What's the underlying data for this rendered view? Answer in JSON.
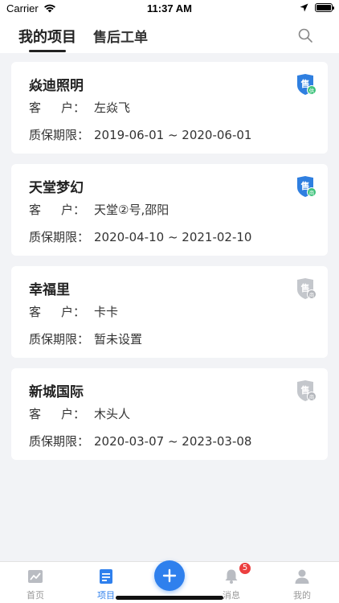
{
  "status_bar": {
    "carrier": "Carrier",
    "time": "11:37 AM"
  },
  "header": {
    "tabs": [
      {
        "label": "我的项目",
        "active": true
      },
      {
        "label": "售后工单",
        "active": false
      }
    ],
    "search_icon": "search-icon"
  },
  "projects": [
    {
      "name": "焱迪照明",
      "client_label": "客户：",
      "client": "左焱飞",
      "warranty_label": "质保期限：",
      "warranty": "2019-06-01 ~ 2020-06-01",
      "badge": {
        "char": "售",
        "sub": "供",
        "state": "active"
      }
    },
    {
      "name": "天堂梦幻",
      "client_label": "客户：",
      "client": "天堂②号,邵阳",
      "warranty_label": "质保期限：",
      "warranty": "2020-04-10 ~ 2021-02-10",
      "badge": {
        "char": "售",
        "sub": "商",
        "state": "active"
      }
    },
    {
      "name": "幸福里",
      "client_label": "客户：",
      "client": "卡卡",
      "warranty_label": "质保期限：",
      "warranty": "暂未设置",
      "badge": {
        "char": "售",
        "sub": "商",
        "state": "inactive"
      }
    },
    {
      "name": "新城国际",
      "client_label": "客户：",
      "client": "木头人",
      "warranty_label": "质保期限：",
      "warranty": "2020-03-07 ~ 2023-03-08",
      "badge": {
        "char": "售",
        "sub": "商",
        "state": "inactive"
      }
    }
  ],
  "tabbar": {
    "items": [
      {
        "label": "首页",
        "icon": "chart-icon",
        "active": false
      },
      {
        "label": "项目",
        "icon": "document-icon",
        "active": true
      },
      {
        "label": "消息",
        "icon": "bell-icon",
        "active": false,
        "badge": "5"
      },
      {
        "label": "我的",
        "icon": "person-icon",
        "active": false
      }
    ],
    "add_icon": "plus-icon"
  },
  "colors": {
    "accent": "#2f80ed",
    "badge_active": "#2f7fe0",
    "badge_sub_green": "#3cc27a",
    "badge_inactive": "#c4c7cc",
    "notify": "#ec3f3f"
  }
}
